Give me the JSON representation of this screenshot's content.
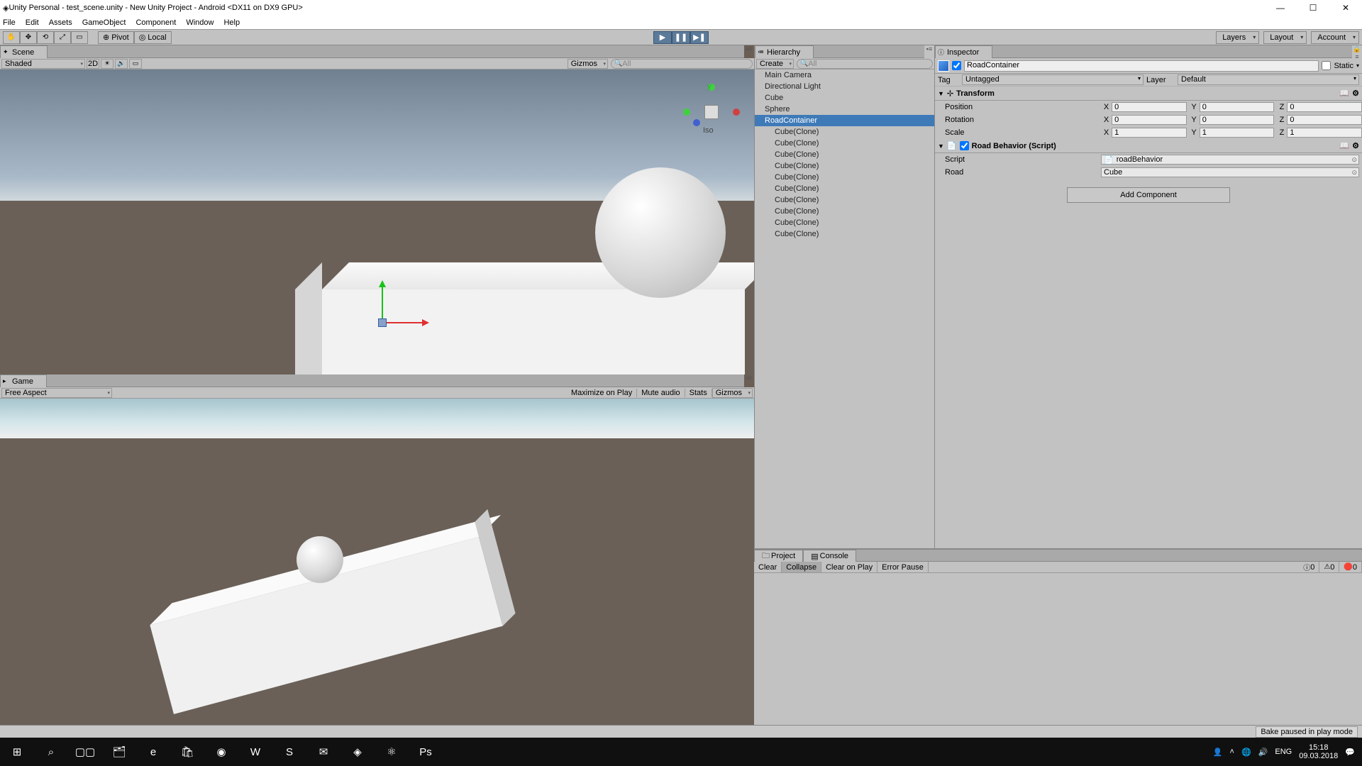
{
  "title": "Unity Personal - test_scene.unity - New Unity Project - Android <DX11 on DX9 GPU>",
  "menu": [
    "File",
    "Edit",
    "Assets",
    "GameObject",
    "Component",
    "Window",
    "Help"
  ],
  "toolbar": {
    "pivot": "Pivot",
    "local": "Local"
  },
  "dropdowns": {
    "layers": "Layers",
    "layout": "Layout",
    "account": "Account"
  },
  "scene": {
    "tab": "Scene",
    "shaded": "Shaded",
    "twoD": "2D",
    "gizmos": "Gizmos",
    "searchPlaceholder": "All",
    "axisY": "y",
    "axisLabel": "Iso"
  },
  "game": {
    "tab": "Game",
    "aspect": "Free Aspect",
    "maximize": "Maximize on Play",
    "mute": "Mute audio",
    "stats": "Stats",
    "gizmos": "Gizmos"
  },
  "hierarchy": {
    "tab": "Hierarchy",
    "create": "Create",
    "searchPlaceholder": "All",
    "items": [
      {
        "label": "Main Camera",
        "sel": false,
        "child": false
      },
      {
        "label": "Directional Light",
        "sel": false,
        "child": false
      },
      {
        "label": "Cube",
        "sel": false,
        "child": false
      },
      {
        "label": "Sphere",
        "sel": false,
        "child": false
      },
      {
        "label": "RoadContainer",
        "sel": true,
        "child": false
      },
      {
        "label": "Cube(Clone)",
        "sel": false,
        "child": true
      },
      {
        "label": "Cube(Clone)",
        "sel": false,
        "child": true
      },
      {
        "label": "Cube(Clone)",
        "sel": false,
        "child": true
      },
      {
        "label": "Cube(Clone)",
        "sel": false,
        "child": true
      },
      {
        "label": "Cube(Clone)",
        "sel": false,
        "child": true
      },
      {
        "label": "Cube(Clone)",
        "sel": false,
        "child": true
      },
      {
        "label": "Cube(Clone)",
        "sel": false,
        "child": true
      },
      {
        "label": "Cube(Clone)",
        "sel": false,
        "child": true
      },
      {
        "label": "Cube(Clone)",
        "sel": false,
        "child": true
      },
      {
        "label": "Cube(Clone)",
        "sel": false,
        "child": true
      }
    ]
  },
  "inspector": {
    "tab": "Inspector",
    "name": "RoadContainer",
    "static": "Static",
    "tagLabel": "Tag",
    "tag": "Untagged",
    "layerLabel": "Layer",
    "layer": "Default",
    "transform": {
      "title": "Transform",
      "position": {
        "label": "Position",
        "x": "0",
        "y": "0",
        "z": "0"
      },
      "rotation": {
        "label": "Rotation",
        "x": "0",
        "y": "0",
        "z": "0"
      },
      "scale": {
        "label": "Scale",
        "x": "1",
        "y": "1",
        "z": "1"
      }
    },
    "roadBehavior": {
      "title": "Road Behavior (Script)",
      "scriptLabel": "Script",
      "script": "roadBehavior",
      "roadLabel": "Road",
      "road": "Cube"
    },
    "addComponent": "Add Component"
  },
  "bottom": {
    "project": "Project",
    "console": "Console",
    "clear": "Clear",
    "collapse": "Collapse",
    "clearOnPlay": "Clear on Play",
    "errorPause": "Error Pause",
    "count0a": "0",
    "count0b": "0",
    "count0c": "0"
  },
  "status": "Bake paused in play mode",
  "tray": {
    "lang": "ENG",
    "time": "15:18",
    "date": "09.03.2018"
  }
}
